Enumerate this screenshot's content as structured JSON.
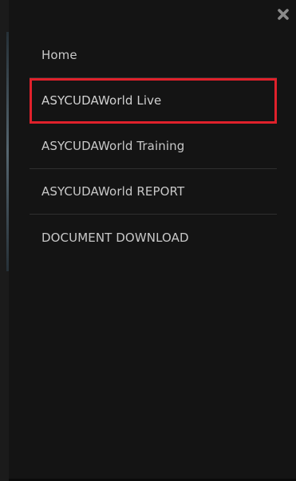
{
  "menu": {
    "close_icon": "close-icon",
    "items": [
      {
        "label": "Home"
      },
      {
        "label": "ASYCUDAWorld Live",
        "highlighted": true
      },
      {
        "label": "ASYCUDAWorld Training"
      },
      {
        "label": "ASYCUDAWorld REPORT"
      },
      {
        "label": "DOCUMENT DOWNLOAD"
      }
    ]
  },
  "colors": {
    "background": "#141414",
    "text": "#c8c8c8",
    "highlight_border": "#e0212b",
    "divider": "#303030"
  }
}
